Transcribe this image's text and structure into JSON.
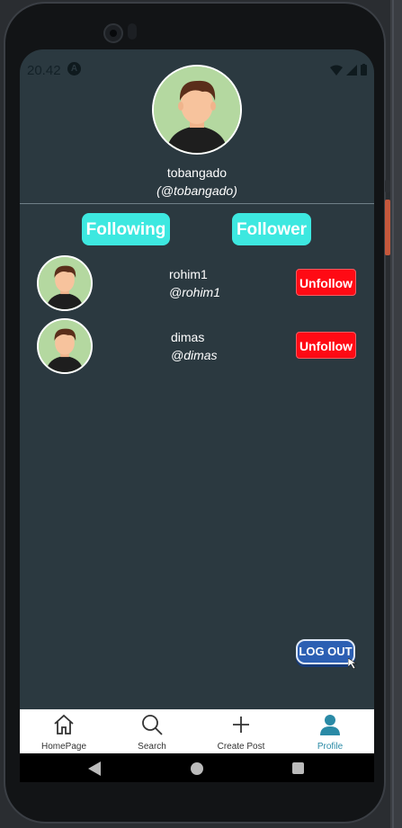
{
  "status_bar": {
    "time": "20.42",
    "notification_icon": "A"
  },
  "profile": {
    "username": "tobangado",
    "handle": "(@tobangado)"
  },
  "tabs": {
    "following_label": "Following",
    "follower_label": "Follower"
  },
  "following": [
    {
      "username": "rohim1",
      "handle": "@rohim1",
      "action_label": "Unfollow"
    },
    {
      "username": "dimas",
      "handle": "@dimas",
      "action_label": "Unfollow"
    }
  ],
  "logout_label": "LOG OUT",
  "bottom_nav": [
    {
      "label": "HomePage",
      "icon": "home-icon"
    },
    {
      "label": "Search",
      "icon": "search-icon"
    },
    {
      "label": "Create Post",
      "icon": "plus-icon"
    },
    {
      "label": "Profile",
      "icon": "person-icon",
      "active": true
    }
  ],
  "colors": {
    "screen_bg": "#2b3940",
    "tab_button": "#3de8e0",
    "unfollow_button": "#ff0a14",
    "logout_button": "#2c5fb3",
    "active_nav": "#2a8aa6"
  }
}
